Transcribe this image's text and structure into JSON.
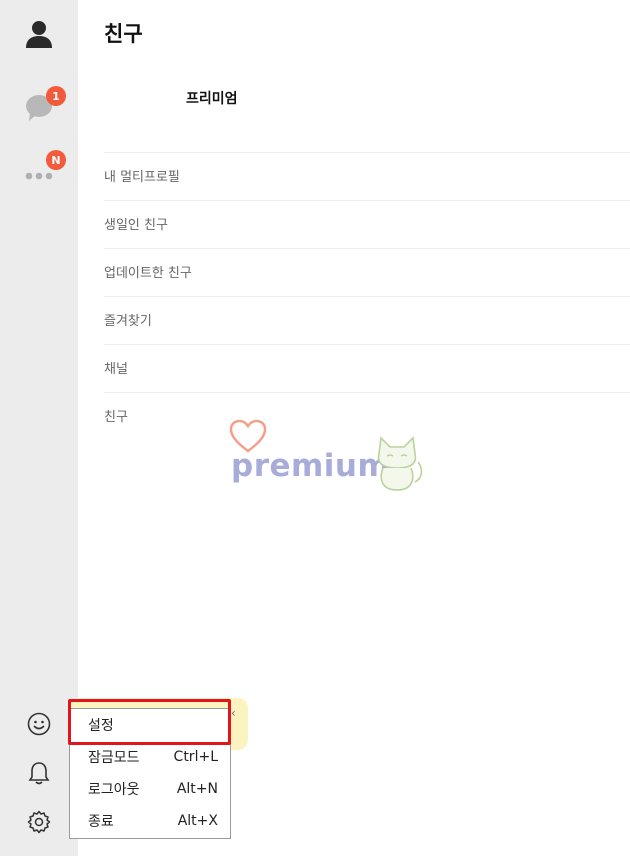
{
  "sidebar": {
    "chats_badge": "1",
    "more_badge": "N",
    "icons": [
      "profile-icon",
      "chat-bubble-icon",
      "more-icon",
      "emoticon-icon",
      "bell-icon",
      "gear-icon"
    ]
  },
  "main": {
    "title": "친구",
    "premium_label": "프리미엄",
    "sections": [
      "내 멀티프로필",
      "생일인 친구",
      "업데이트한 친구",
      "즐겨찾기",
      "채널",
      "친구"
    ]
  },
  "watermark": {
    "text": "premium"
  },
  "menu": {
    "settings": "설정",
    "lock_mode": "잠금모드",
    "lock_shortcut": "Ctrl+L",
    "logout": "로그아웃",
    "logout_shortcut": "Alt+N",
    "exit": "종료",
    "exit_shortcut": "Alt+X"
  },
  "colors": {
    "badge": "#f15a3a",
    "highlight": "#e3151c",
    "sidebar": "#ececec",
    "tip": "#fbf3c0"
  }
}
